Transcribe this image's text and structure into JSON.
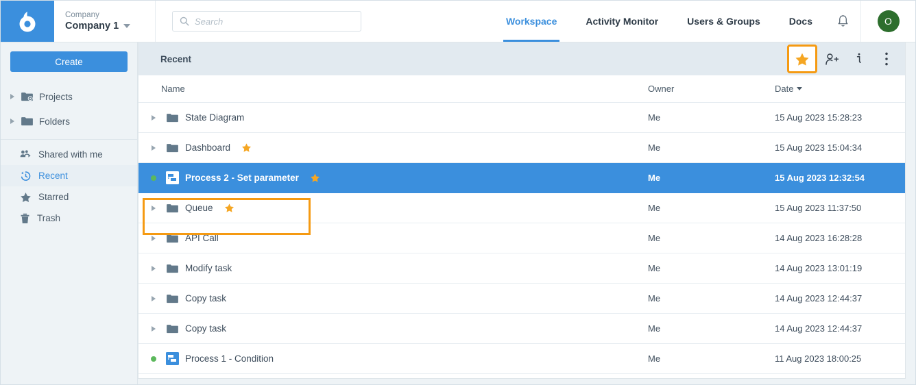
{
  "header": {
    "logo_icon": "brand-logo-icon",
    "company_label": "Company",
    "company_name": "Company 1",
    "search": {
      "placeholder": "Search",
      "value": "",
      "icon": "search-icon"
    },
    "nav": [
      {
        "label": "Workspace",
        "active": true
      },
      {
        "label": "Activity Monitor",
        "active": false
      },
      {
        "label": "Users & Groups",
        "active": false
      },
      {
        "label": "Docs",
        "active": false
      }
    ],
    "bell_icon": "notification-bell-icon",
    "avatar_initial": "O",
    "avatar_color": "#2d6e2d"
  },
  "sidebar": {
    "create_label": "Create",
    "tree": [
      {
        "label": "Projects",
        "icon": "projects-folder-icon"
      },
      {
        "label": "Folders",
        "icon": "folder-icon"
      }
    ],
    "nav": [
      {
        "label": "Shared with me",
        "icon": "shared-users-icon",
        "selected": false
      },
      {
        "label": "Recent",
        "icon": "recent-clock-icon",
        "selected": true
      },
      {
        "label": "Starred",
        "icon": "star-icon",
        "selected": false
      },
      {
        "label": "Trash",
        "icon": "trash-icon",
        "selected": false
      }
    ]
  },
  "toolbar": {
    "title": "Recent",
    "buttons": [
      {
        "name": "star-button",
        "icon": "star-icon",
        "highlighted": true
      },
      {
        "name": "share-button",
        "icon": "add-user-icon",
        "highlighted": false
      },
      {
        "name": "info-button",
        "icon": "info-icon",
        "highlighted": false
      },
      {
        "name": "more-button",
        "icon": "more-vertical-icon",
        "highlighted": false
      }
    ]
  },
  "table": {
    "columns": {
      "name": "Name",
      "owner": "Owner",
      "date": "Date"
    },
    "sort_column": "Date",
    "sort_direction": "desc",
    "rows": [
      {
        "name": "State Diagram",
        "type": "folder",
        "starred": false,
        "owner": "Me",
        "date": "15 Aug 2023 15:28:23",
        "selected": false
      },
      {
        "name": "Dashboard",
        "type": "folder",
        "starred": true,
        "owner": "Me",
        "date": "15 Aug 2023 15:04:34",
        "selected": false
      },
      {
        "name": "Process 2 - Set parameter",
        "type": "process",
        "starred": true,
        "owner": "Me",
        "date": "15 Aug 2023 12:32:54",
        "selected": true
      },
      {
        "name": "Queue",
        "type": "folder",
        "starred": true,
        "owner": "Me",
        "date": "15 Aug 2023 11:37:50",
        "selected": false
      },
      {
        "name": "API Call",
        "type": "folder",
        "starred": false,
        "owner": "Me",
        "date": "14 Aug 2023 16:28:28",
        "selected": false
      },
      {
        "name": "Modify task",
        "type": "folder",
        "starred": false,
        "owner": "Me",
        "date": "14 Aug 2023 13:01:19",
        "selected": false
      },
      {
        "name": "Copy task",
        "type": "folder",
        "starred": false,
        "owner": "Me",
        "date": "14 Aug 2023 12:44:37",
        "selected": false
      },
      {
        "name": "Copy task",
        "type": "folder",
        "starred": false,
        "owner": "Me",
        "date": "14 Aug 2023 12:44:37",
        "selected": false
      },
      {
        "name": "Process 1 - Condition",
        "type": "process",
        "starred": false,
        "owner": "Me",
        "date": "11 Aug 2023 18:00:25",
        "selected": false
      }
    ]
  },
  "colors": {
    "accent_blue": "#3b8fdd",
    "highlight_orange": "#f59a12",
    "star_orange": "#f5a623",
    "status_green": "#5cb85c",
    "page_bg": "#eef3f6"
  }
}
